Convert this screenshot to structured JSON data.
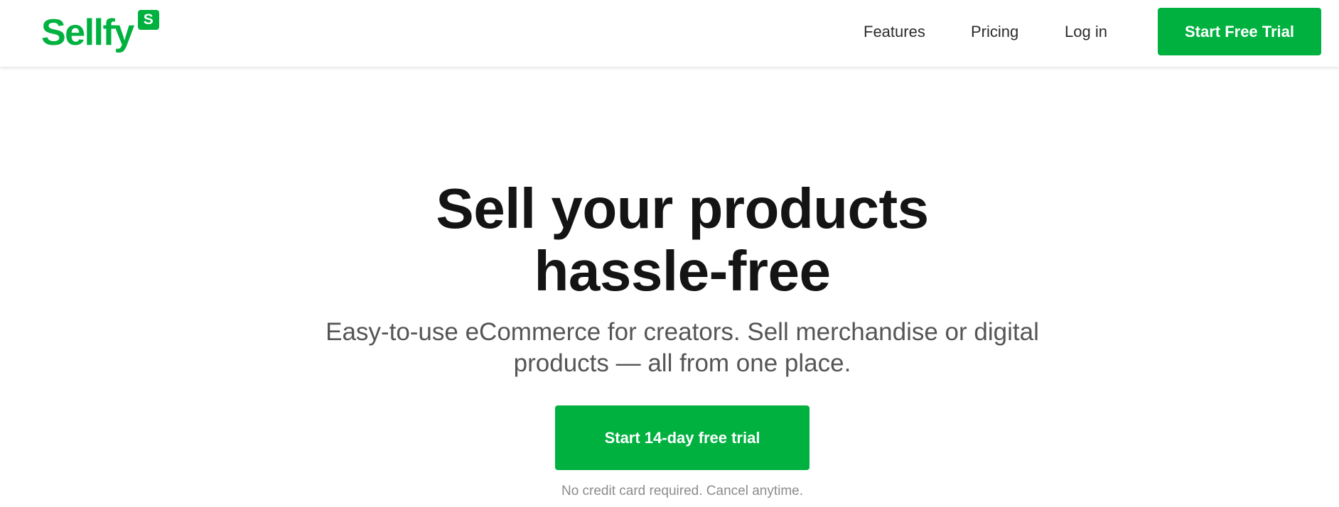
{
  "brand": {
    "name": "Sellfy",
    "badge_letter": "S",
    "color": "#00b140"
  },
  "nav": {
    "features": "Features",
    "pricing": "Pricing",
    "login": "Log in",
    "cta": "Start Free Trial"
  },
  "hero": {
    "title_line1": "Sell your products",
    "title_line2": "hassle-free",
    "subtitle_line1": "Easy-to-use eCommerce for creators. Sell merchandise or digital",
    "subtitle_line2": "products — all from one place.",
    "cta": "Start 14-day free trial",
    "note": "No credit card required. Cancel anytime."
  },
  "colors": {
    "accent": "#00b140",
    "text_dark": "#141414",
    "text_muted": "#555555",
    "text_light": "#8c8c8c"
  }
}
